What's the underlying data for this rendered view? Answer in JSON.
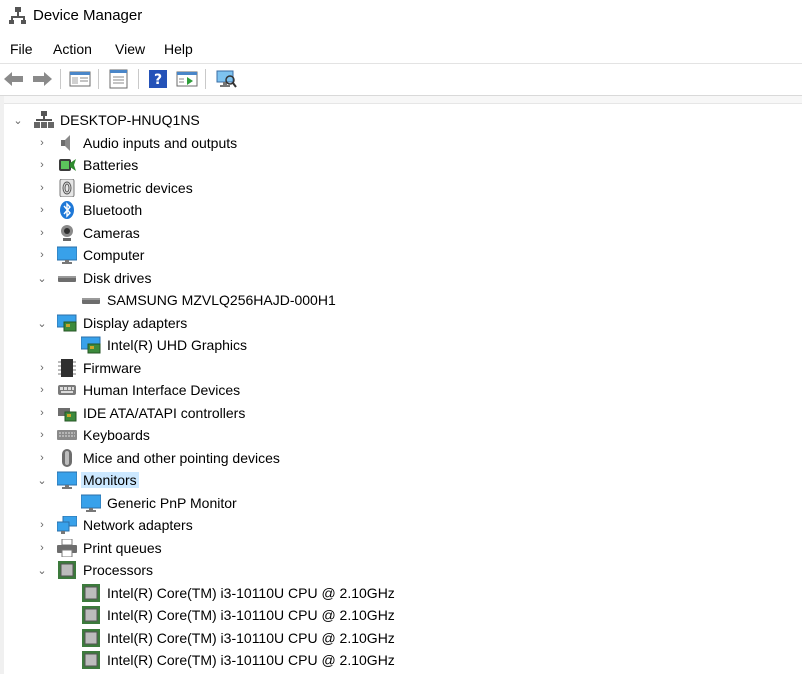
{
  "window": {
    "title": "Device Manager"
  },
  "menu": {
    "items": [
      "File",
      "Action",
      "View",
      "Help"
    ]
  },
  "toolbar": {
    "buttons": [
      "back-arrow-icon",
      "forward-arrow-icon",
      "show-hide-tree-icon",
      "properties-icon",
      "help-icon",
      "run-icon",
      "scan-hardware-icon"
    ]
  },
  "tree": {
    "root": "DESKTOP-HNUQ1NS",
    "items": [
      {
        "label": "Audio inputs and outputs",
        "icon": "speaker-icon",
        "expanded": false
      },
      {
        "label": "Batteries",
        "icon": "battery-icon",
        "expanded": false
      },
      {
        "label": "Biometric devices",
        "icon": "fingerprint-icon",
        "expanded": false
      },
      {
        "label": "Bluetooth",
        "icon": "bluetooth-icon",
        "expanded": false
      },
      {
        "label": "Cameras",
        "icon": "camera-icon",
        "expanded": false
      },
      {
        "label": "Computer",
        "icon": "computer-icon",
        "expanded": false
      },
      {
        "label": "Disk drives",
        "icon": "disk-drive-icon",
        "expanded": true
      },
      {
        "label": "SAMSUNG MZVLQ256HAJD-000H1",
        "icon": "disk-drive-icon",
        "child": true
      },
      {
        "label": "Display adapters",
        "icon": "display-adapter-icon",
        "expanded": true
      },
      {
        "label": "Intel(R) UHD Graphics",
        "icon": "display-adapter-icon",
        "child": true
      },
      {
        "label": "Firmware",
        "icon": "firmware-chip-icon",
        "expanded": false
      },
      {
        "label": "Human Interface Devices",
        "icon": "hid-icon",
        "expanded": false
      },
      {
        "label": "IDE ATA/ATAPI controllers",
        "icon": "ide-controller-icon",
        "expanded": false
      },
      {
        "label": "Keyboards",
        "icon": "keyboard-icon",
        "expanded": false
      },
      {
        "label": "Mice and other pointing devices",
        "icon": "mouse-icon",
        "expanded": false
      },
      {
        "label": "Monitors",
        "icon": "monitor-icon",
        "expanded": true,
        "selected": true
      },
      {
        "label": "Generic PnP Monitor",
        "icon": "monitor-icon",
        "child": true
      },
      {
        "label": "Network adapters",
        "icon": "network-adapter-icon",
        "expanded": false
      },
      {
        "label": "Print queues",
        "icon": "printer-icon",
        "expanded": false
      },
      {
        "label": "Processors",
        "icon": "processor-icon",
        "expanded": true
      },
      {
        "label": "Intel(R) Core(TM) i3-10110U CPU @ 2.10GHz",
        "icon": "processor-icon",
        "child": true
      },
      {
        "label": "Intel(R) Core(TM) i3-10110U CPU @ 2.10GHz",
        "icon": "processor-icon",
        "child": true
      },
      {
        "label": "Intel(R) Core(TM) i3-10110U CPU @ 2.10GHz",
        "icon": "processor-icon",
        "child": true
      },
      {
        "label": "Intel(R) Core(TM) i3-10110U CPU @ 2.10GHz",
        "icon": "processor-icon",
        "child": true
      }
    ]
  },
  "colors": {
    "selection": "#cce8ff",
    "accent": "#1e78d7"
  }
}
